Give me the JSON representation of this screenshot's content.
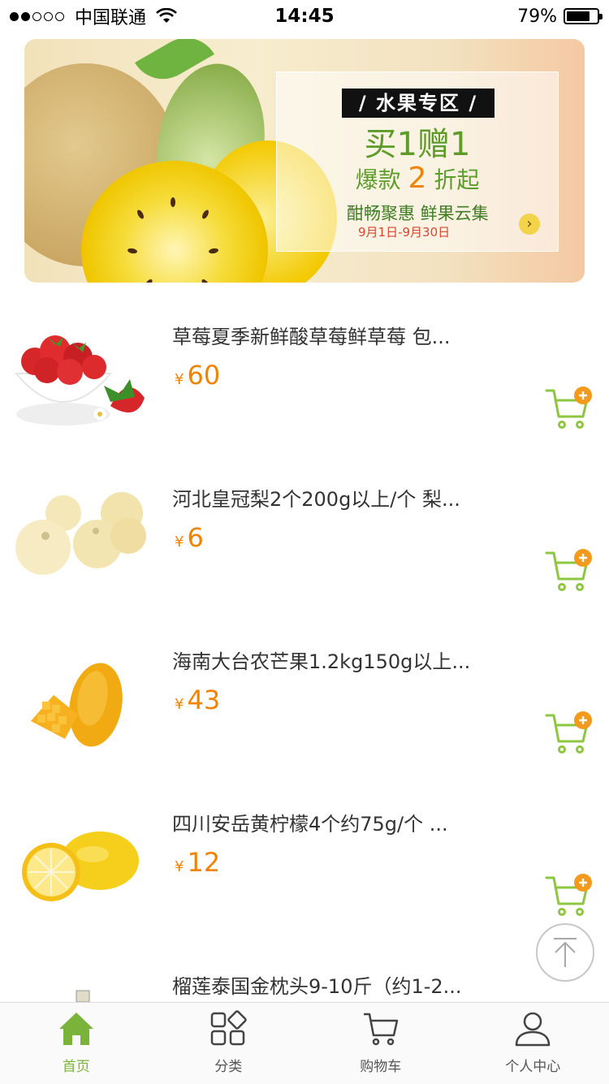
{
  "status_bar": {
    "carrier": "中国联通",
    "time": "14:45",
    "battery": "79%",
    "battery_level": 0.79,
    "signal_bars_filled": 2,
    "signal_bars_total": 5
  },
  "banner": {
    "tag": "/ 水果专区 /",
    "line1": "买1赠1",
    "line2_prefix": "爆款",
    "line2_number": "2",
    "line2_suffix": "折起",
    "line3": "酣畅聚惠  鲜果云集",
    "line4": "9月1日-9月30日",
    "arrow_icon": "chevron-right-icon"
  },
  "products": [
    {
      "name": "草莓夏季新鲜酸草莓鲜草莓 包...",
      "currency": "¥",
      "price": "60",
      "image": "strawberry"
    },
    {
      "name": "河北皇冠梨2个200g以上/个 梨...",
      "currency": "¥",
      "price": "6",
      "image": "pear"
    },
    {
      "name": "海南大台农芒果1.2kg150g以上...",
      "currency": "¥",
      "price": "43",
      "image": "mango"
    },
    {
      "name": "四川安岳黄柠檬4个约75g/个 ...",
      "currency": "¥",
      "price": "12",
      "image": "lemon"
    },
    {
      "name": "榴莲泰国金枕头9-10斤（约1-2...",
      "currency": "¥",
      "price": "",
      "image": "durian"
    }
  ],
  "tabs": [
    {
      "label": "首页",
      "icon": "home-icon",
      "active": true
    },
    {
      "label": "分类",
      "icon": "category-icon",
      "active": false
    },
    {
      "label": "购物车",
      "icon": "cart-icon",
      "active": false
    },
    {
      "label": "个人中心",
      "icon": "user-icon",
      "active": false
    }
  ],
  "colors": {
    "accent_green": "#7ab33a",
    "price_orange": "#f08300",
    "cart_badge_orange": "#f39a1c"
  }
}
